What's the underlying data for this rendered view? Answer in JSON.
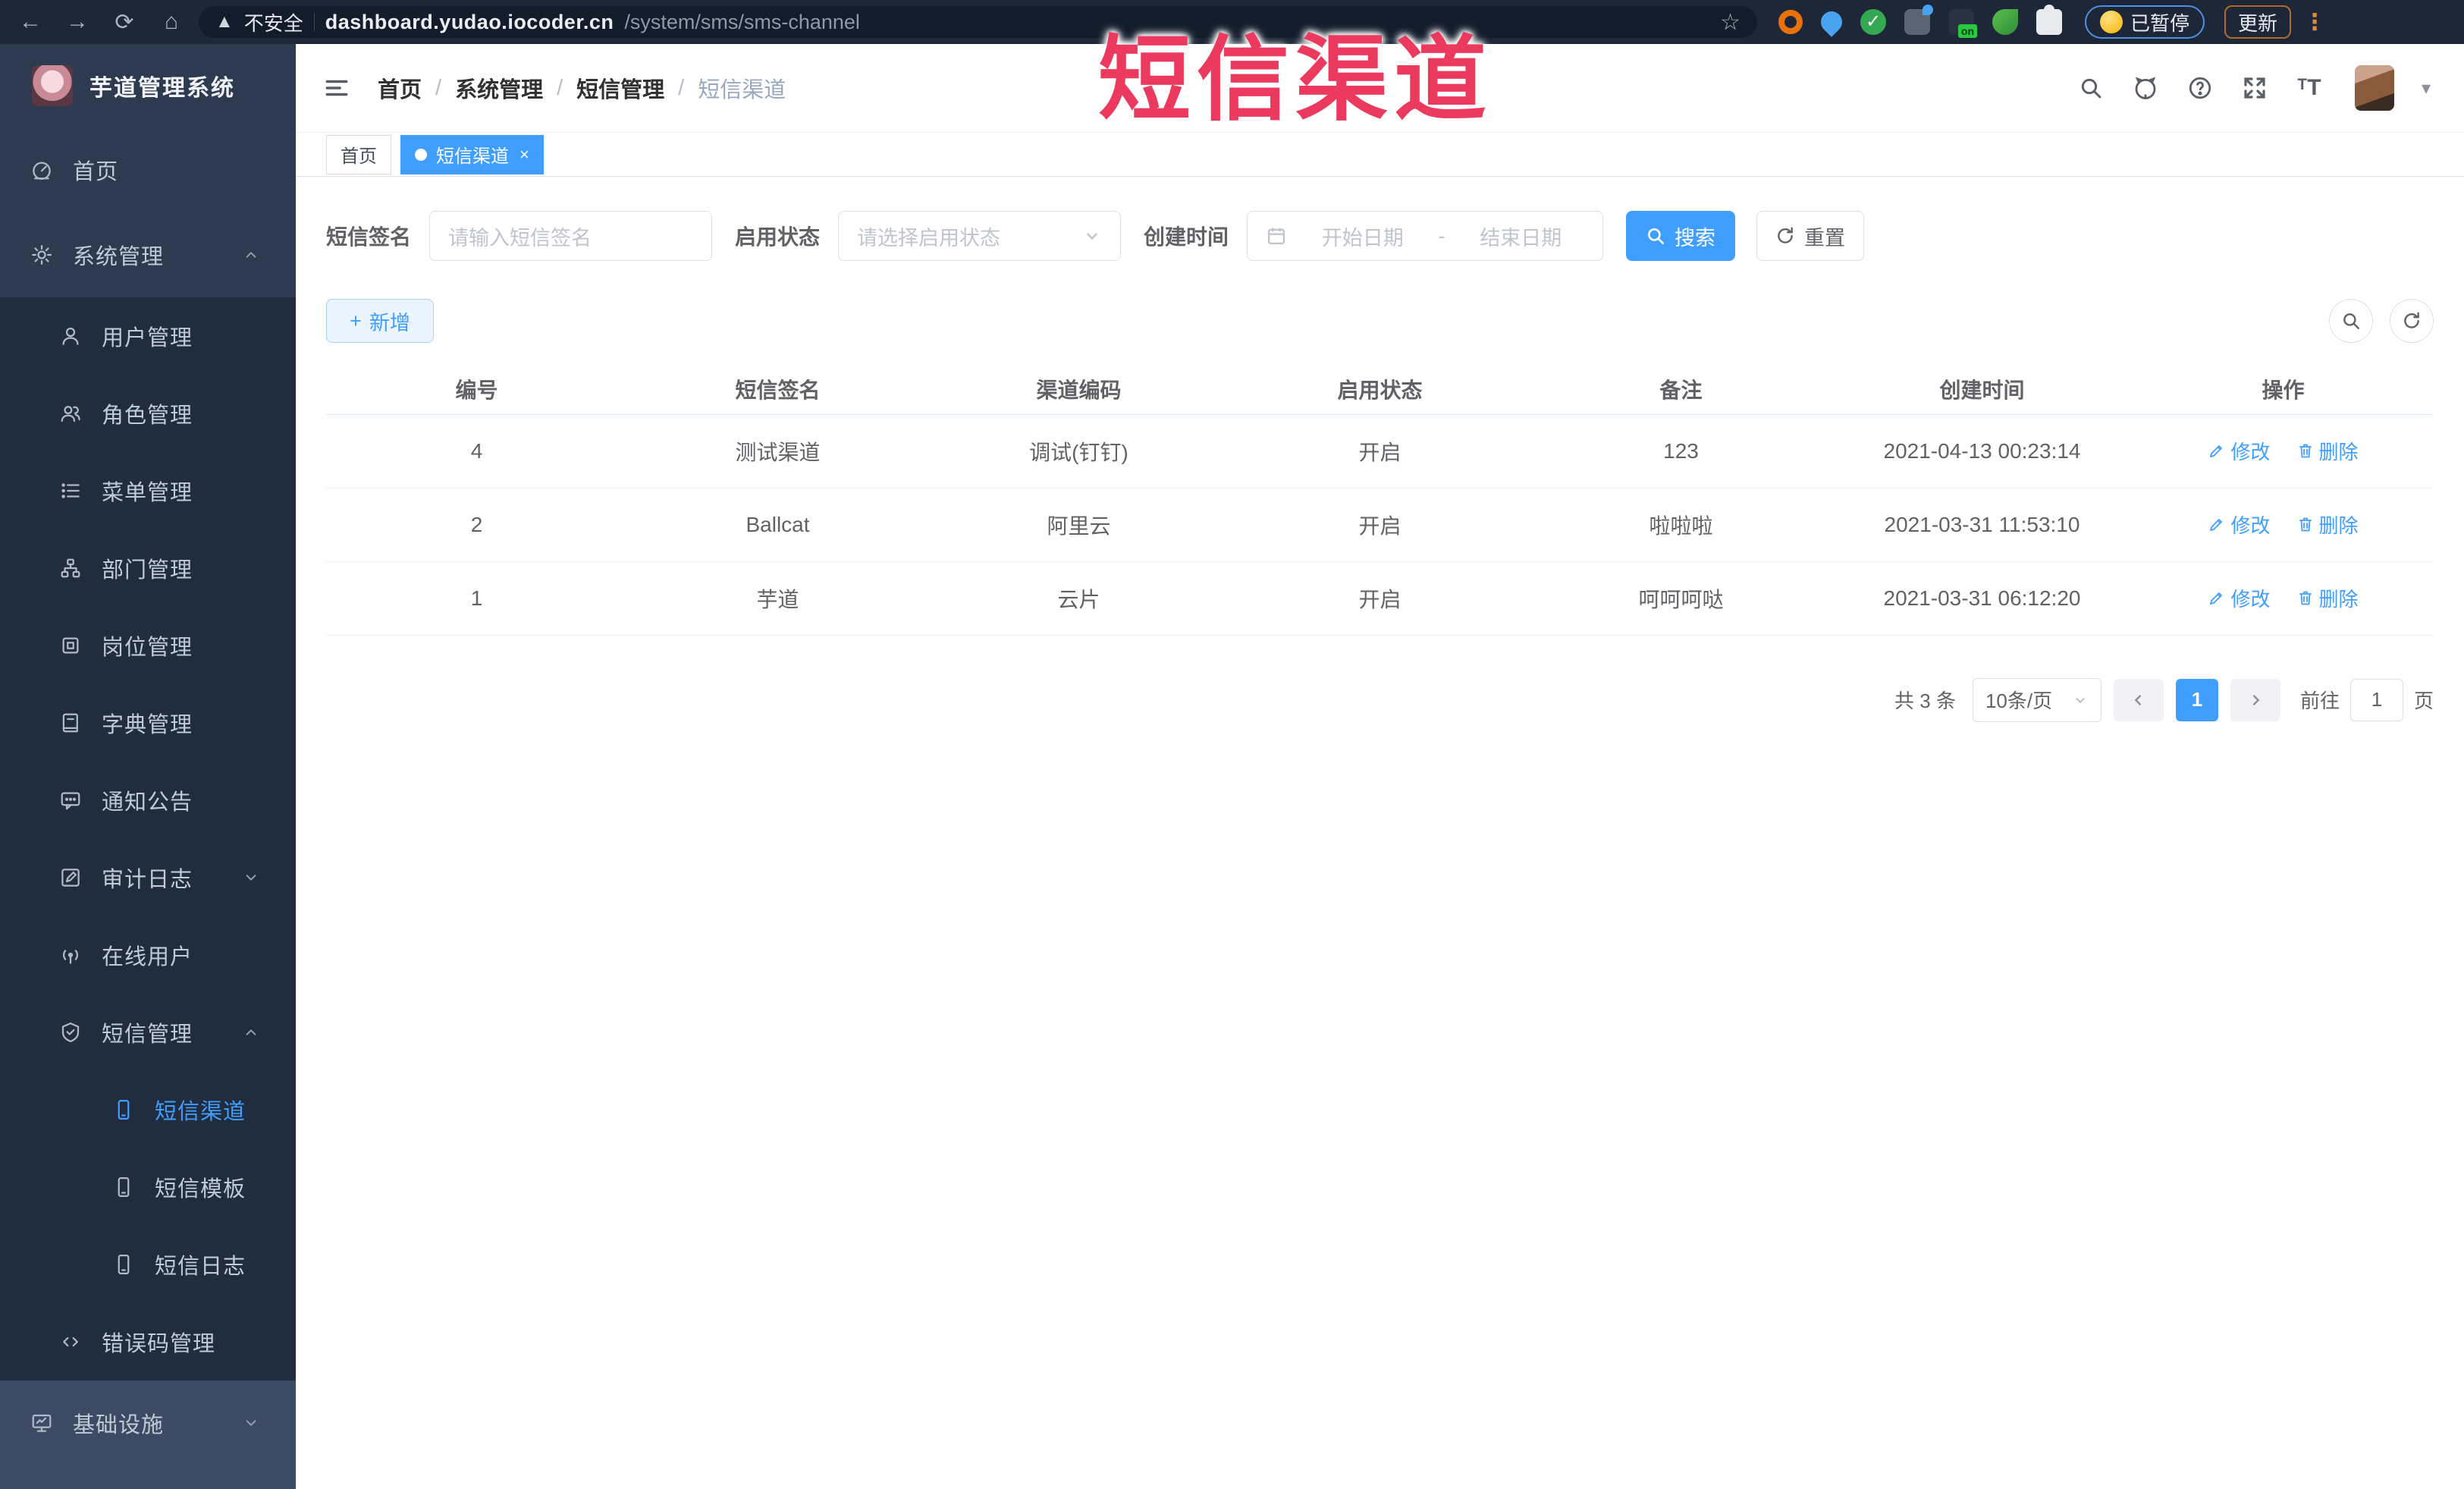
{
  "browser": {
    "security_warning": "不安全",
    "url_host": "dashboard.yudao.iocoder.cn",
    "url_path": "/system/sms/sms-channel",
    "paused_badge": "已暂停",
    "update_button": "更新",
    "extension_icons": [
      "orange-ring-extension-icon",
      "location-pin-extension-icon",
      "green-check-extension-icon",
      "sliders-extension-icon",
      "note-on-extension-icon",
      "plant-extension-icon",
      "puzzle-extensions-icon"
    ]
  },
  "overlay": {
    "title": "短信渠道",
    "color": "#ec3a5e"
  },
  "sidebar": {
    "app_title": "芋道管理系统",
    "menu": [
      {
        "label": "首页",
        "icon": "dashboard-icon",
        "level": 1
      },
      {
        "label": "系统管理",
        "icon": "gear-icon",
        "level": 1,
        "chevron": "up"
      },
      {
        "label": "用户管理",
        "icon": "user-icon",
        "level": 2,
        "sub": true
      },
      {
        "label": "角色管理",
        "icon": "role-icon",
        "level": 2,
        "sub": true
      },
      {
        "label": "菜单管理",
        "icon": "menu-list-icon",
        "level": 2,
        "sub": true
      },
      {
        "label": "部门管理",
        "icon": "dept-tree-icon",
        "level": 2,
        "sub": true
      },
      {
        "label": "岗位管理",
        "icon": "post-icon",
        "level": 2,
        "sub": true
      },
      {
        "label": "字典管理",
        "icon": "dict-icon",
        "level": 2,
        "sub": true
      },
      {
        "label": "通知公告",
        "icon": "notice-icon",
        "level": 2,
        "sub": true
      },
      {
        "label": "审计日志",
        "icon": "audit-icon",
        "level": 2,
        "sub": true,
        "chevron": "down"
      },
      {
        "label": "在线用户",
        "icon": "online-icon",
        "level": 2,
        "sub": true
      },
      {
        "label": "短信管理",
        "icon": "sms-shield-icon",
        "level": 2,
        "sub": true,
        "chevron": "up"
      },
      {
        "label": "短信渠道",
        "icon": "phone-icon",
        "level": 3,
        "sub": true,
        "active": true
      },
      {
        "label": "短信模板",
        "icon": "phone-icon",
        "level": 3,
        "sub": true
      },
      {
        "label": "短信日志",
        "icon": "phone-icon",
        "level": 3,
        "sub": true
      },
      {
        "label": "错误码管理",
        "icon": "code-icon",
        "level": 2,
        "sub": true
      },
      {
        "label": "基础设施",
        "icon": "infra-monitor-icon",
        "level": 1,
        "chevron": "down",
        "bottom": true
      }
    ]
  },
  "breadcrumb": {
    "items": [
      "首页",
      "系统管理",
      "短信管理",
      "短信渠道"
    ]
  },
  "tabs": {
    "items": [
      {
        "label": "首页",
        "active": false
      },
      {
        "label": "短信渠道",
        "active": true,
        "closable": true
      }
    ]
  },
  "filters": {
    "sign_label": "短信签名",
    "sign_placeholder": "请输入短信签名",
    "status_label": "启用状态",
    "status_placeholder": "请选择启用状态",
    "time_label": "创建时间",
    "start_placeholder": "开始日期",
    "range_separator": "-",
    "end_placeholder": "结束日期",
    "search_label": "搜索",
    "reset_label": "重置"
  },
  "toolbar": {
    "add_label": "新增"
  },
  "table": {
    "headers": [
      "编号",
      "短信签名",
      "渠道编码",
      "启用状态",
      "备注",
      "创建时间",
      "操作"
    ],
    "rows": [
      {
        "id": "4",
        "sign": "测试渠道",
        "code": "调试(钉钉)",
        "status": "开启",
        "remark": "123",
        "created": "2021-04-13 00:23:14"
      },
      {
        "id": "2",
        "sign": "Ballcat",
        "code": "阿里云",
        "status": "开启",
        "remark": "啦啦啦",
        "created": "2021-03-31 11:53:10"
      },
      {
        "id": "1",
        "sign": "芋道",
        "code": "云片",
        "status": "开启",
        "remark": "呵呵呵哒",
        "created": "2021-03-31 06:12:20"
      }
    ],
    "edit_label": "修改",
    "delete_label": "删除"
  },
  "pagination": {
    "total_text": "共 3 条",
    "page_size_text": "10条/页",
    "current_page": "1",
    "goto_label": "前往",
    "goto_value": "1",
    "page_unit": "页"
  },
  "colors": {
    "accent_blue": "#409EFF",
    "annotation_red": "#ec3a5e",
    "sidebar_bg": "#2e3a50"
  }
}
